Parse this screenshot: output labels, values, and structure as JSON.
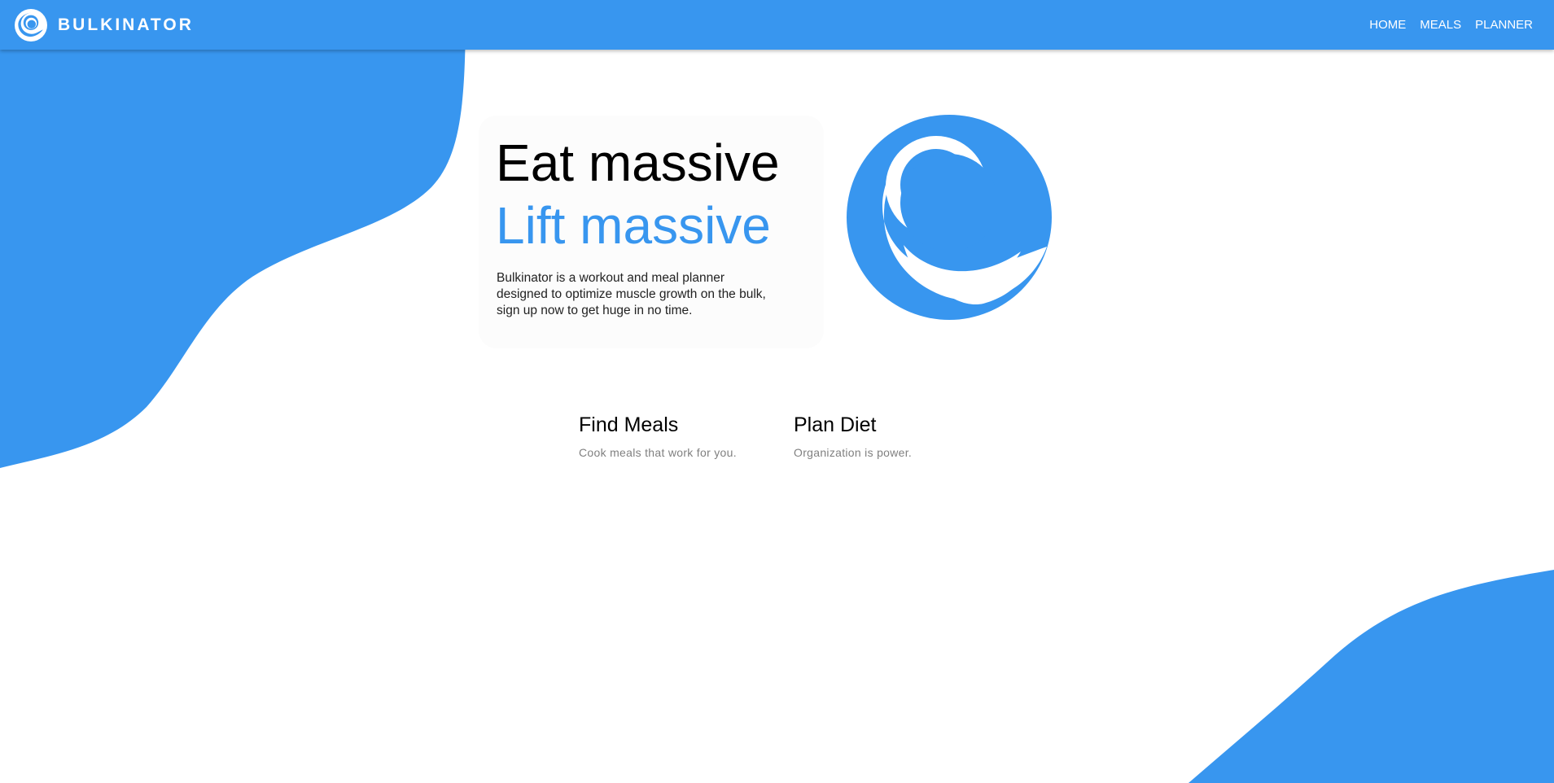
{
  "brand": {
    "name": "BULKINATOR",
    "logo_icon": "swirl-logo-icon"
  },
  "nav": {
    "items": [
      {
        "label": "HOME"
      },
      {
        "label": "MEALS"
      },
      {
        "label": "PLANNER"
      }
    ]
  },
  "hero": {
    "line1": "Eat massive",
    "line2": "Lift massive",
    "description": "Bulkinator is a workout and meal planner designed to optimize muscle growth on the bulk, sign up now to get huge in no time.",
    "logo_icon": "swirl-logo-icon"
  },
  "features": [
    {
      "title": "Find Meals",
      "subtitle": "Cook meals that work for you."
    },
    {
      "title": "Plan Diet",
      "subtitle": "Organization is power."
    }
  ],
  "colors": {
    "accent": "#3896ef",
    "background": "#ffffff",
    "text": "#000000",
    "muted_text": "#808080"
  }
}
